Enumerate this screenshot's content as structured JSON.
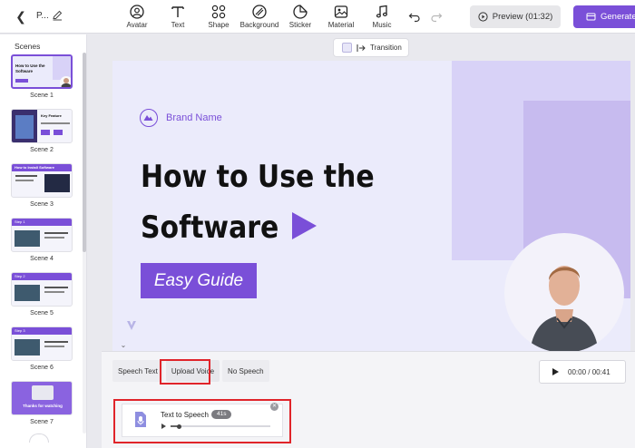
{
  "header": {
    "project_name": "P...",
    "tools": [
      {
        "label": "Avatar",
        "icon": "avatar-icon"
      },
      {
        "label": "Text",
        "icon": "text-icon"
      },
      {
        "label": "Shape",
        "icon": "shape-icon"
      },
      {
        "label": "Background",
        "icon": "background-icon"
      },
      {
        "label": "Sticker",
        "icon": "sticker-icon"
      },
      {
        "label": "Material",
        "icon": "material-icon"
      },
      {
        "label": "Music",
        "icon": "music-icon"
      }
    ],
    "preview_label": "Preview (01:32)",
    "generate_label": "Generate"
  },
  "sidebar": {
    "title": "Scenes",
    "scenes": [
      {
        "label": "Scene 1",
        "active": true
      },
      {
        "label": "Scene 2"
      },
      {
        "label": "Scene 3"
      },
      {
        "label": "Scene 4"
      },
      {
        "label": "Scene 5"
      },
      {
        "label": "Scene 6"
      },
      {
        "label": "Scene 7"
      }
    ],
    "thumb_texts": {
      "s1_title": "How to Use the Software",
      "s2_title": "Key Feature",
      "s3_title": "How to Install Software",
      "s4_title": "Step 1",
      "s5_title": "Step 2",
      "s6_title": "Step 3",
      "s7_title": "Thanks for watching"
    }
  },
  "canvas": {
    "transition_label": "Transition",
    "slide": {
      "brand_name": "Brand Name",
      "title_line1": "How to Use the",
      "title_line2": "Software",
      "badge": "Easy Guide"
    }
  },
  "panel": {
    "tabs": [
      "Speech Text",
      "Upload Voice",
      "No Speech"
    ],
    "time": "00:00 / 00:41",
    "audio": {
      "title": "Text to Speech",
      "duration": "41s",
      "progress": 0.08
    }
  },
  "colors": {
    "accent": "#7a4fd8",
    "highlight": "#e0242a",
    "slide_bg": "#ebebfb"
  }
}
